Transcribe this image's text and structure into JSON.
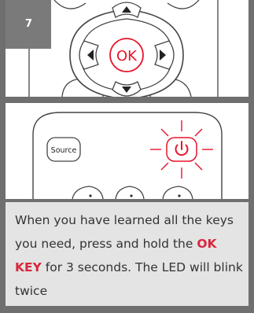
{
  "step": {
    "number": "7"
  },
  "remote": {
    "ok_label": "OK",
    "source_label": "Source"
  },
  "instruction": {
    "part1": "When you have learned all the keys you need, press and hold the ",
    "key": "OK KEY",
    "part2": " for 3 seconds. The LED will blink twice"
  },
  "colors": {
    "accent": "#e8132a",
    "frame": "#6f6f6f",
    "text_panel": "#e4e4e4",
    "text": "#333333"
  }
}
